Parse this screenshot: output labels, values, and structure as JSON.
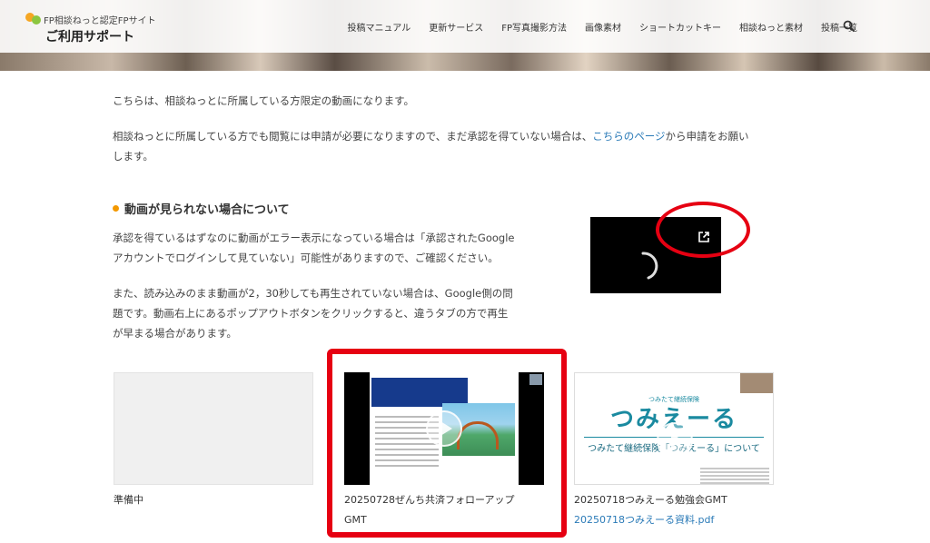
{
  "header": {
    "logo_sub": "FP相談ねっと認定FPサイト",
    "logo_main": "ご利用サポート",
    "nav": [
      "投稿マニュアル",
      "更新サービス",
      "FP写真撮影方法",
      "画像素材",
      "ショートカットキー",
      "相談ねっと素材",
      "投稿一覧"
    ],
    "search_icon": "search-icon"
  },
  "intro": {
    "p1": "こちらは、相談ねっとに所属している方限定の動画になります。",
    "p2_before": "相談ねっとに所属している方でも閲覧には申請が必要になりますので、まだ承認を得ていない場合は、",
    "p2_link": "こちらのページ",
    "p2_after": "から申請をお願い",
    "p2_line2": "します。"
  },
  "section": {
    "heading": "動画が見られない場合について",
    "p1_line1": "承認を得ているはずなのに動画がエラー表示になっている場合は「承認されたGoogle",
    "p1_line2": "アカウントでログインして見ていない」可能性がありますので、ご確認ください。",
    "p2_line1": "また、読み込みのまま動画が2，30秒しても再生されていない場合は、Google側の問",
    "p2_line2": "題です。動画右上にあるポップアウトボタンをクリックすると、違うタブの方で再生",
    "p2_line3": "が早まる場合があります。"
  },
  "videos": [
    {
      "caption": "準備中"
    },
    {
      "caption_line1": "20250728ぜんち共済フォローアップ",
      "caption_line2": "GMT"
    },
    {
      "caption": "20250718つみえーる勉強会GMT",
      "link": "20250718つみえーる資料.pdf",
      "slide_top": "つみたて継続保険",
      "slide_logo": "つみえーる",
      "slide_sub": "つみたて継続保険「つみえーる」について"
    }
  ],
  "colors": {
    "accent": "#f39800",
    "link": "#2a7ab7",
    "highlight": "#e60012"
  }
}
